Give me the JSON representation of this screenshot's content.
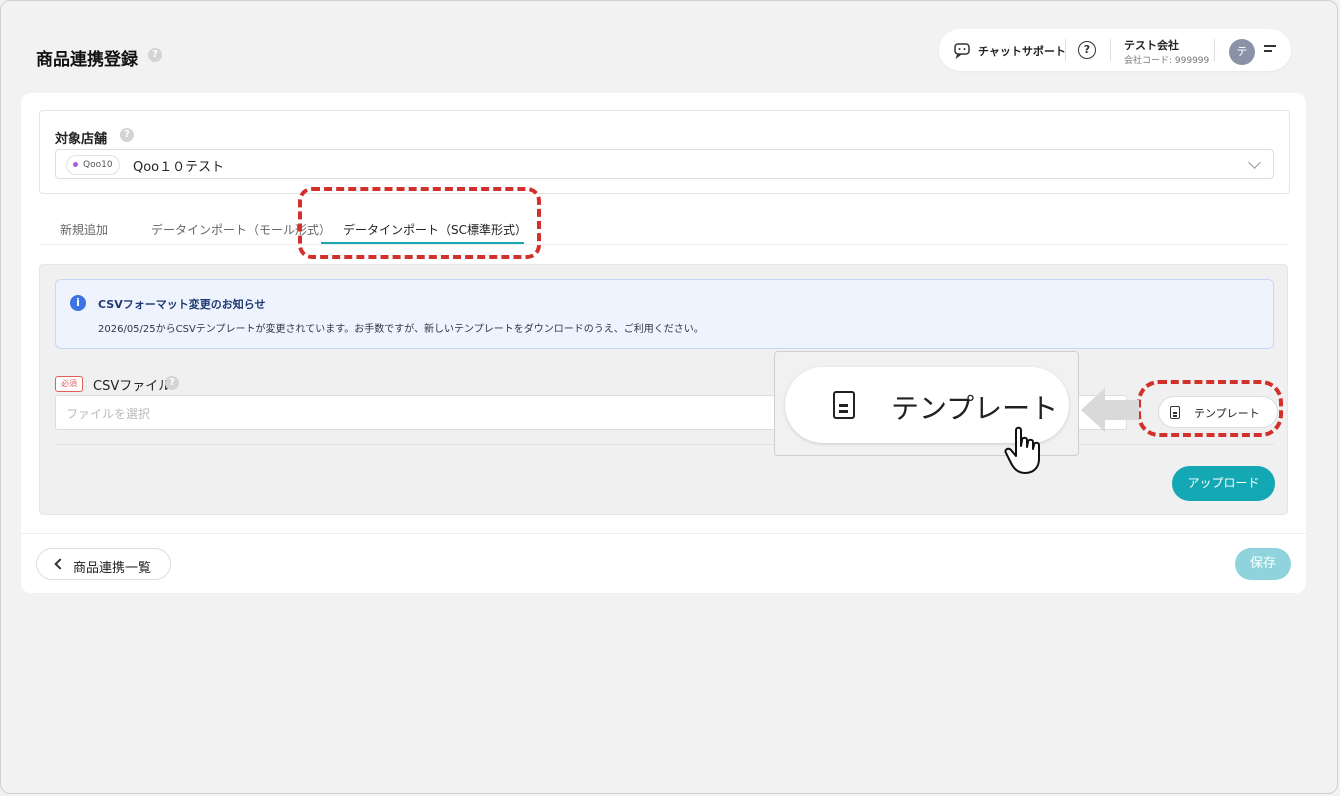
{
  "page": {
    "title": "商品連携登録",
    "help": "?"
  },
  "header": {
    "chat_support": "チャットサポート",
    "help_icon": "?",
    "company_name": "テスト会社",
    "company_code": "会社コード: 999999",
    "avatar_initial": "テ"
  },
  "store": {
    "label": "対象店舗",
    "badge": "Qoo10",
    "selected": "Qoo１０テスト"
  },
  "tabs": [
    {
      "label": "新規追加",
      "active": false
    },
    {
      "label": "データインポート（モール形式）",
      "active": false
    },
    {
      "label": "データインポート（SC標準形式）",
      "active": true
    }
  ],
  "notice": {
    "title": "CSVフォーマット変更のお知らせ",
    "text": "2026/05/25からCSVテンプレートが変更されています。お手数ですが、新しいテンプレートをダウンロードのうえ、ご利用ください。"
  },
  "csv": {
    "required": "必須",
    "label": "CSVファイル",
    "placeholder": "ファイルを選択",
    "template_button": "テンプレート",
    "upload_button": "アップロード"
  },
  "zoom": {
    "label": "テンプレート"
  },
  "footer": {
    "back_label": "商品連携一覧",
    "save_label": "保存"
  },
  "colors": {
    "accent": "#14a8b4",
    "annotation": "#d2312b",
    "info": "#3b73e3",
    "required": "#e35d5d"
  }
}
